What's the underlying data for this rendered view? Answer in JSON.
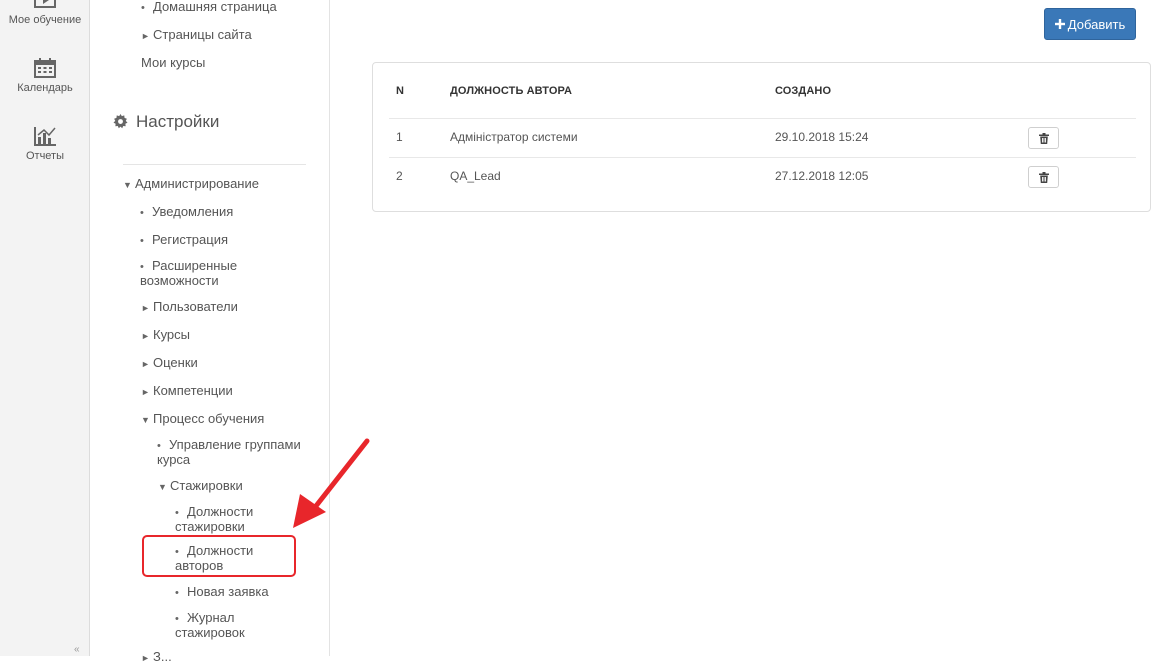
{
  "rail": {
    "items": [
      {
        "label": "Мое обучение",
        "icon": "play-icon"
      },
      {
        "label": "Календарь",
        "icon": "calendar-icon"
      },
      {
        "label": "Отчеты",
        "icon": "chart-icon"
      }
    ],
    "collapse": "«"
  },
  "tree": {
    "top_items": [
      {
        "label": "Домашняя страница",
        "marker": "•"
      },
      {
        "label": "Страницы сайта",
        "marker": "►"
      }
    ],
    "my_courses": "Мои курсы",
    "settings_title": "Настройки",
    "admin": {
      "label": "Администрирование",
      "marker": "▼"
    },
    "admin_items": [
      {
        "label": "Уведомления",
        "marker": "•"
      },
      {
        "label": "Регистрация",
        "marker": "•"
      },
      {
        "label": "Расширенные",
        "label2": "возможности",
        "marker": "•"
      },
      {
        "label": "Пользователи",
        "marker": "►"
      },
      {
        "label": "Курсы",
        "marker": "►"
      },
      {
        "label": "Оценки",
        "marker": "►"
      },
      {
        "label": "Компетенции",
        "marker": "►"
      },
      {
        "label": "Процесс обучения",
        "marker": "▼"
      }
    ],
    "learning_items": [
      {
        "label": "Управление группами",
        "label2": "курса",
        "marker": "•"
      },
      {
        "label": "Стажировки",
        "marker": "▼"
      }
    ],
    "internship_items": [
      {
        "label": "Должности",
        "label2": "стажировки",
        "marker": "•"
      },
      {
        "label": "Должности",
        "label2": "авторов",
        "marker": "•"
      },
      {
        "label": "Новая заявка",
        "marker": "•"
      },
      {
        "label": "Журнал",
        "label2": "стажировок",
        "marker": "•"
      }
    ],
    "cut_item": "З..."
  },
  "main": {
    "add_button": "Добавить",
    "table": {
      "headers": [
        "N",
        "ДОЛЖНОСТЬ АВТОРА",
        "СОЗДАНО"
      ],
      "rows": [
        {
          "n": "1",
          "position": "Адміністратор системи",
          "created": "29.10.2018 15:24"
        },
        {
          "n": "2",
          "position": "QA_Lead",
          "created": "27.12.2018 12:05"
        }
      ]
    }
  },
  "annotation": {
    "color": "#e8262b"
  }
}
